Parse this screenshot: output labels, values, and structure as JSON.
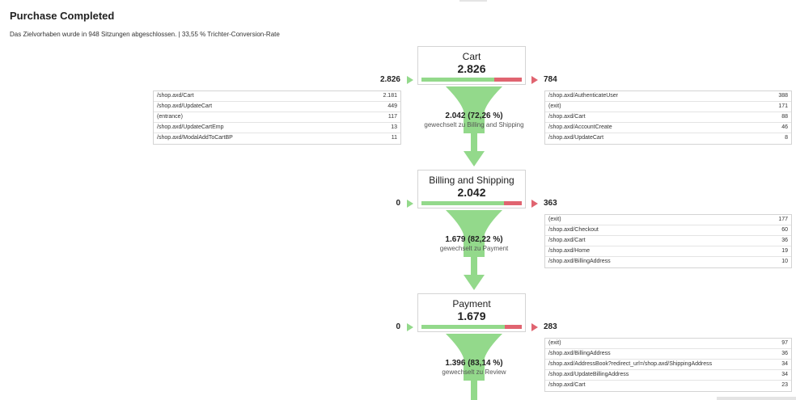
{
  "header": {
    "title": "Purchase Completed",
    "subtitle": "Das Zielvorhaben wurde in 948 Sitzungen abgeschlossen. | 33,55 % Trichter-Conversion-Rate"
  },
  "colors": {
    "green": "#93d98b",
    "red": "#e06470",
    "border": "#d4d4d4"
  },
  "steps": [
    {
      "name": "Cart",
      "count": "2.826",
      "entries": "2.826",
      "exits": "784",
      "proceed_fraction": 0.7226,
      "entry_sources": [
        {
          "page": "/shop.axd/Cart",
          "count": "2.181"
        },
        {
          "page": "/shop.axd/UpdateCart",
          "count": "449"
        },
        {
          "page": "(entrance)",
          "count": "117"
        },
        {
          "page": "/shop.axd/UpdateCartEmp",
          "count": "13"
        },
        {
          "page": "/shop.axd/ModalAddToCartBP",
          "count": "11"
        }
      ],
      "exit_destinations": [
        {
          "page": "/shop.axd/AuthenticateUser",
          "count": "388"
        },
        {
          "page": "(exit)",
          "count": "171"
        },
        {
          "page": "/shop.axd/Cart",
          "count": "88"
        },
        {
          "page": "/shop.axd/AccountCreate",
          "count": "46"
        },
        {
          "page": "/shop.axd/UpdateCart",
          "count": "8"
        }
      ],
      "transition": {
        "value": "2.042 (72,26 %)",
        "label": "gewechselt zu Billing and Shipping"
      }
    },
    {
      "name": "Billing and Shipping",
      "count": "2.042",
      "entries": "0",
      "exits": "363",
      "proceed_fraction": 0.8222,
      "exit_destinations": [
        {
          "page": "(exit)",
          "count": "177"
        },
        {
          "page": "/shop.axd/Checkout",
          "count": "60"
        },
        {
          "page": "/shop.axd/Cart",
          "count": "36"
        },
        {
          "page": "/shop.axd/Home",
          "count": "19"
        },
        {
          "page": "/shop.axd/BillingAddress",
          "count": "10"
        }
      ],
      "transition": {
        "value": "1.679 (82,22 %)",
        "label": "gewechselt zu Payment"
      }
    },
    {
      "name": "Payment",
      "count": "1.679",
      "entries": "0",
      "exits": "283",
      "proceed_fraction": 0.8314,
      "exit_destinations": [
        {
          "page": "(exit)",
          "count": "97"
        },
        {
          "page": "/shop.axd/BillingAddress",
          "count": "36"
        },
        {
          "page": "/shop.axd/AddressBook?redirect_url=/shop.axd/ShippingAddress",
          "count": "34"
        },
        {
          "page": "/shop.axd/UpdateBillingAddress",
          "count": "34"
        },
        {
          "page": "/shop.axd/Cart",
          "count": "23"
        }
      ],
      "transition": {
        "value": "1.396 (83,14 %)",
        "label": "gewechselt zu Review"
      }
    }
  ]
}
